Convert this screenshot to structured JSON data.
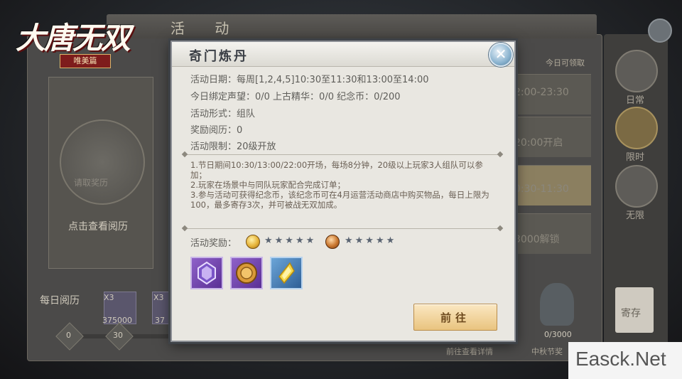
{
  "game": {
    "logo_text": "大唐无双",
    "logo_sub": "唯美篇"
  },
  "background": {
    "header_title": "活 动",
    "card_seal_text": "请取奖历",
    "card_text": "点击查看阅历",
    "daily_label": "每日阅历",
    "items": [
      {
        "mult": "X3",
        "count": "375000"
      },
      {
        "mult": "X3",
        "count": "37"
      }
    ],
    "track_nums": [
      "0",
      "30"
    ],
    "rows": [
      {
        "time": "2:00-23:30"
      },
      {
        "time": "20:00开启"
      },
      {
        "time": "0:30-11:30"
      },
      {
        "time": "3000解锁"
      }
    ],
    "side_tabs": [
      {
        "label": "日常"
      },
      {
        "label": "限时"
      },
      {
        "label": "无限"
      }
    ],
    "store_label": "寄存",
    "vase_count": "0/3000",
    "reward_hint": "今日可领取",
    "bottom_texts": [
      "前往查看详情",
      "中秋节奖"
    ]
  },
  "modal": {
    "title": "奇门炼丹",
    "close_icon": "close-x-icon",
    "info": {
      "date": "活动日期：每周[1,2,4,5]10:30至11:30和13:00至14:00",
      "today": "今日绑定声望：0/0  上古精华：0/0  纪念币：0/200",
      "form": "活动形式：组队",
      "reward_exp": "奖励阅历：0",
      "limit": "活动限制：20级开放"
    },
    "rules": [
      "1.节日期间10:30/13:00/22:00开场，每场8分钟，20级以上玩家3人组队可以参加；",
      "2.玩家在场景中与同队玩家配合完成订单；",
      "3.参与活动可获得纪念币，该纪念币可在4月运营活动商店中购买物品，每日上限为100，最多寄存3次，并可被战无双加成。"
    ],
    "reward_label": "活动奖励：",
    "reward_ratings": [
      {
        "icon": "gold-coin-icon",
        "stars": "★★★★★"
      },
      {
        "icon": "bronze-coin-icon",
        "stars": "★★★★★"
      }
    ],
    "items": [
      {
        "icon": "crystal-gem-icon",
        "rarity": "purple"
      },
      {
        "icon": "bronze-coin-item-icon",
        "rarity": "purple"
      },
      {
        "icon": "gold-crystal-icon",
        "rarity": "blue"
      }
    ],
    "go_button": "前往"
  },
  "watermark": "Easck.Net"
}
